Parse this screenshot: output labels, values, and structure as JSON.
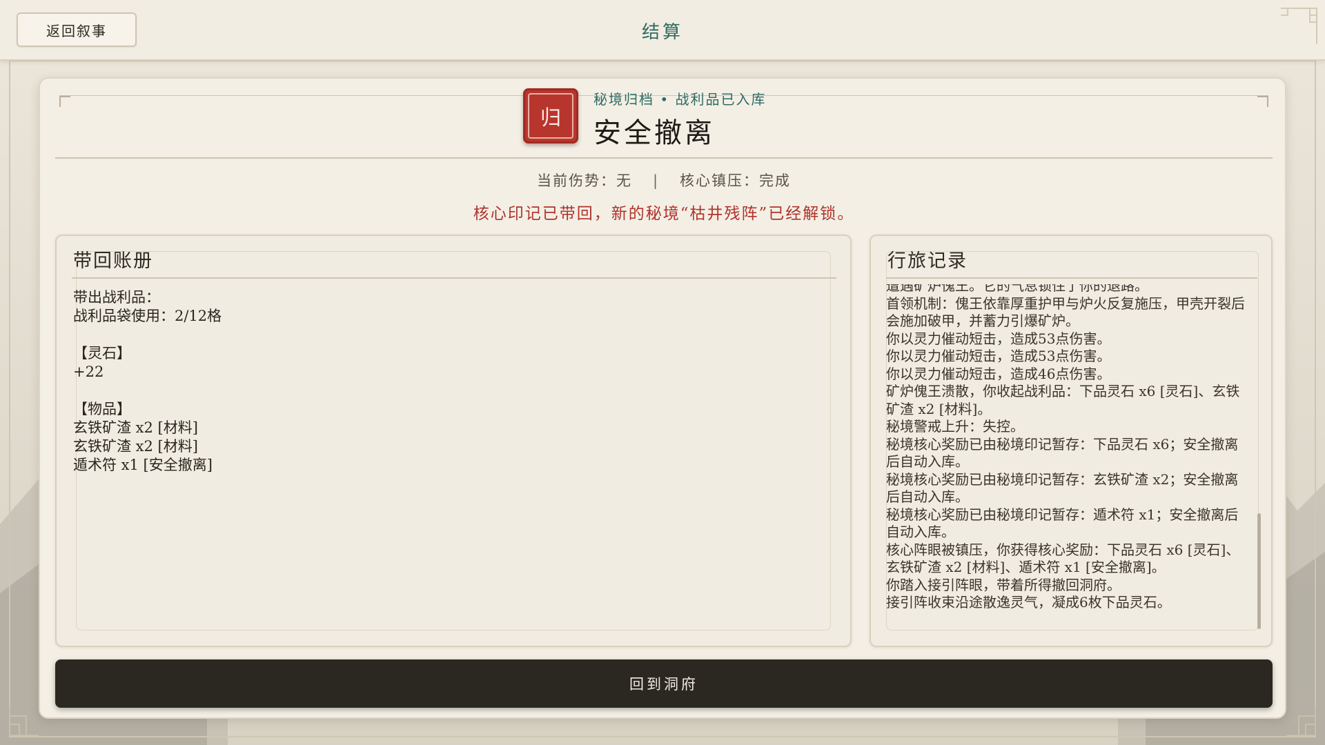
{
  "topbar": {
    "back_label": "返回叙事",
    "title": "结算"
  },
  "header": {
    "seal_glyph": "归",
    "subtitle": "秘境归档 • 战利品已入库",
    "title": "安全撤离",
    "injury_label": "当前伤势：",
    "injury_value": "无",
    "separator": "|",
    "core_label": "核心镇压：",
    "core_value": "完成",
    "unlock_message": "核心印记已带回，新的秘境“枯井残阵”已经解锁。"
  },
  "ledger": {
    "title": "带回账册",
    "lines": [
      "带出战利品：",
      "战利品袋使用：2/12格",
      "",
      "【灵石】",
      "+22",
      "",
      "【物品】",
      "玄铁矿渣 x2 [材料]",
      "玄铁矿渣 x2 [材料]",
      "遁术符 x1 [安全撤离]"
    ]
  },
  "journal": {
    "title": "行旅记录",
    "entries": [
      "遭遇矿炉傀王。它的气息锁住了你的退路。",
      "首领机制：傀王依靠厚重护甲与炉火反复施压，甲壳开裂后会施加破甲，并蓄力引爆矿炉。",
      "你以灵力催动短击，造成53点伤害。",
      "你以灵力催动短击，造成53点伤害。",
      "你以灵力催动短击，造成46点伤害。",
      "矿炉傀王溃散，你收起战利品：下品灵石 x6 [灵石]、玄铁矿渣 x2 [材料]。",
      "秘境警戒上升：失控。",
      "秘境核心奖励已由秘境印记暂存：下品灵石 x6；安全撤离后自动入库。",
      "秘境核心奖励已由秘境印记暂存：玄铁矿渣 x2；安全撤离后自动入库。",
      "秘境核心奖励已由秘境印记暂存：遁术符 x1；安全撤离后自动入库。",
      "核心阵眼被镇压，你获得核心奖励：下品灵石 x6 [灵石]、玄铁矿渣 x2 [材料]、遁术符 x1 [安全撤离]。",
      "你踏入接引阵眼，带着所得撤回洞府。",
      "接引阵收束沿途散逸灵气，凝成6枚下品灵石。"
    ]
  },
  "footer": {
    "return_label": "回到洞府"
  },
  "colors": {
    "accent_teal": "#2e6b62",
    "seal_red": "#b8352d",
    "alert_red": "#b0332b",
    "button_dark": "#2b2822"
  }
}
